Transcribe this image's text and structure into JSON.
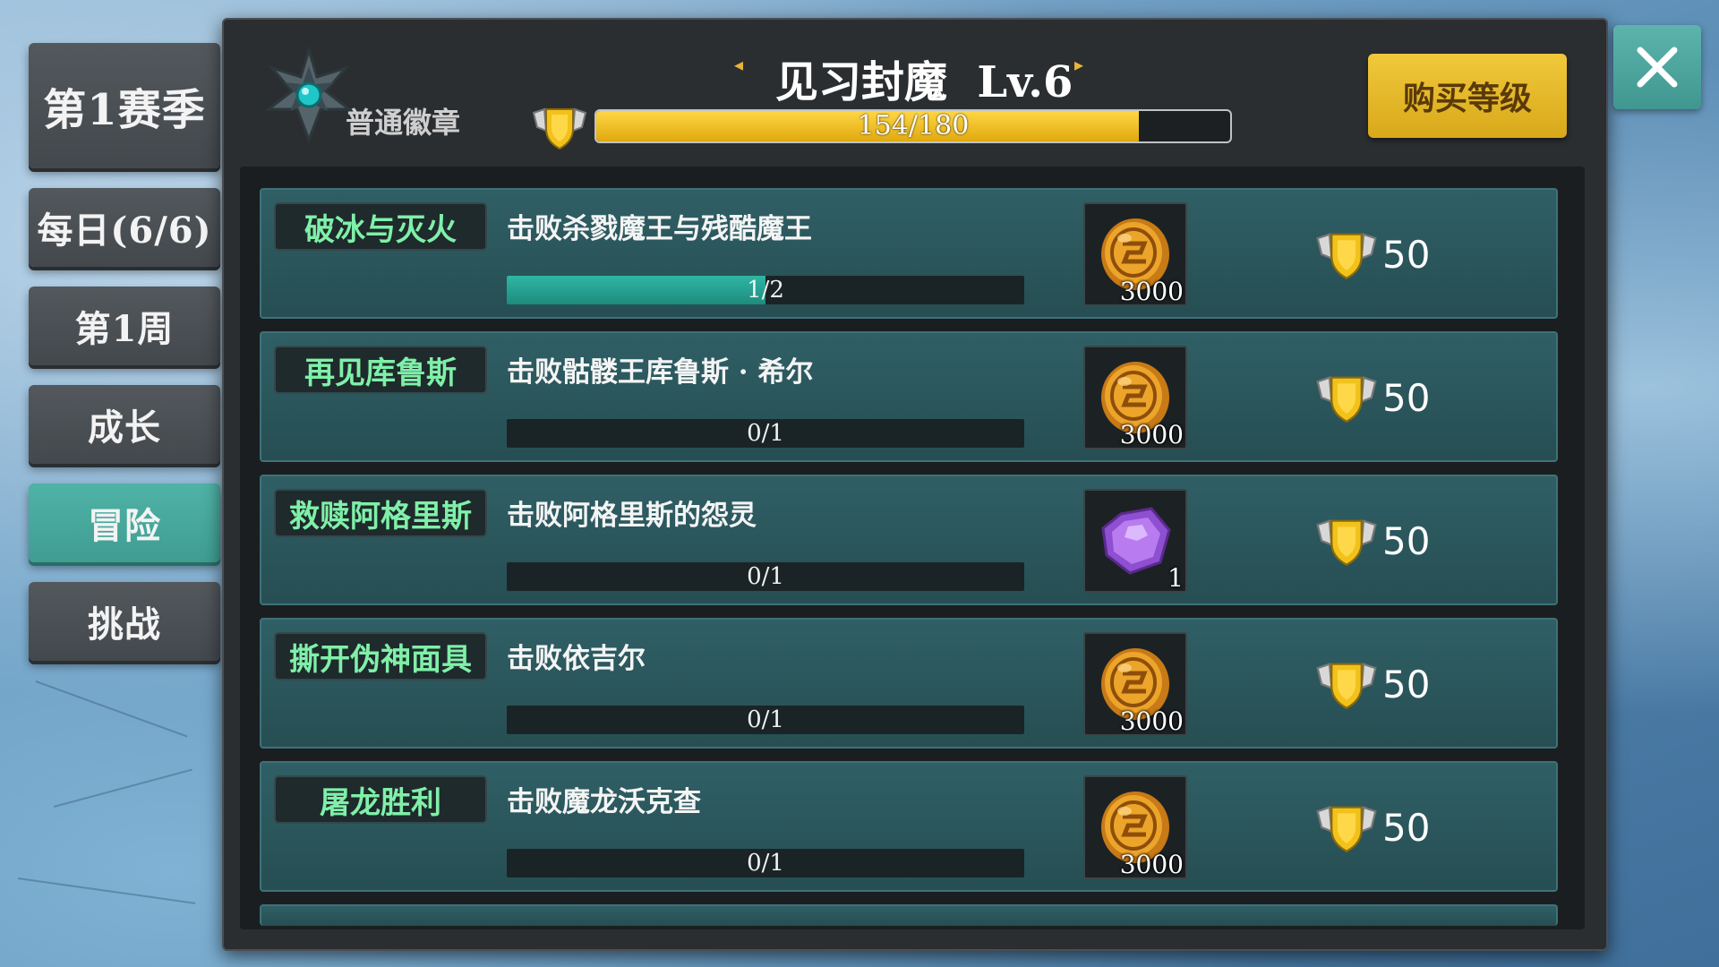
{
  "sidebar": {
    "tabs": [
      {
        "label": "第1赛季",
        "active": false
      },
      {
        "label": "每日(6/6)",
        "active": false
      },
      {
        "label": "第1周",
        "active": false
      },
      {
        "label": "成长",
        "active": false
      },
      {
        "label": "冒险",
        "active": true
      },
      {
        "label": "挑战",
        "active": false
      }
    ]
  },
  "header": {
    "badge_label": "普通徽章",
    "title": "见习封魔  Lv.6",
    "xp_text": "154/180",
    "xp_progress": 0.856,
    "buy_button": "购买等级"
  },
  "quests": [
    {
      "name": "破冰与灭火",
      "desc": "击败杀戮魔王与残酷魔王",
      "progress_text": "1/2",
      "progress": 0.5,
      "item": "coin",
      "item_count": "3000",
      "reward": "50"
    },
    {
      "name": "再见库鲁斯",
      "desc": "击败骷髅王库鲁斯 · 希尔",
      "progress_text": "0/1",
      "progress": 0,
      "item": "coin",
      "item_count": "3000",
      "reward": "50"
    },
    {
      "name": "救赎阿格里斯",
      "desc": "击败阿格里斯的怨灵",
      "progress_text": "0/1",
      "progress": 0,
      "item": "purple-gem",
      "item_count": "1",
      "reward": "50"
    },
    {
      "name": "撕开伪神面具",
      "desc": "击败依吉尔",
      "progress_text": "0/1",
      "progress": 0,
      "item": "coin",
      "item_count": "3000",
      "reward": "50"
    },
    {
      "name": "屠龙胜利",
      "desc": "击败魔龙沃克查",
      "progress_text": "0/1",
      "progress": 0,
      "item": "coin",
      "item_count": "3000",
      "reward": "50"
    }
  ],
  "icons": {
    "close": "close-icon",
    "badge": "emblem-icon",
    "xp": "winged-shield-icon",
    "coin": "gold-coin-icon",
    "gem": "purple-gem-icon"
  },
  "colors": {
    "accent_teal": "#3f9d92",
    "quest_name_green": "#7ff0a8",
    "xp_bar_yellow": "#f2c21b",
    "buy_button_gold": "#e8be2c"
  }
}
